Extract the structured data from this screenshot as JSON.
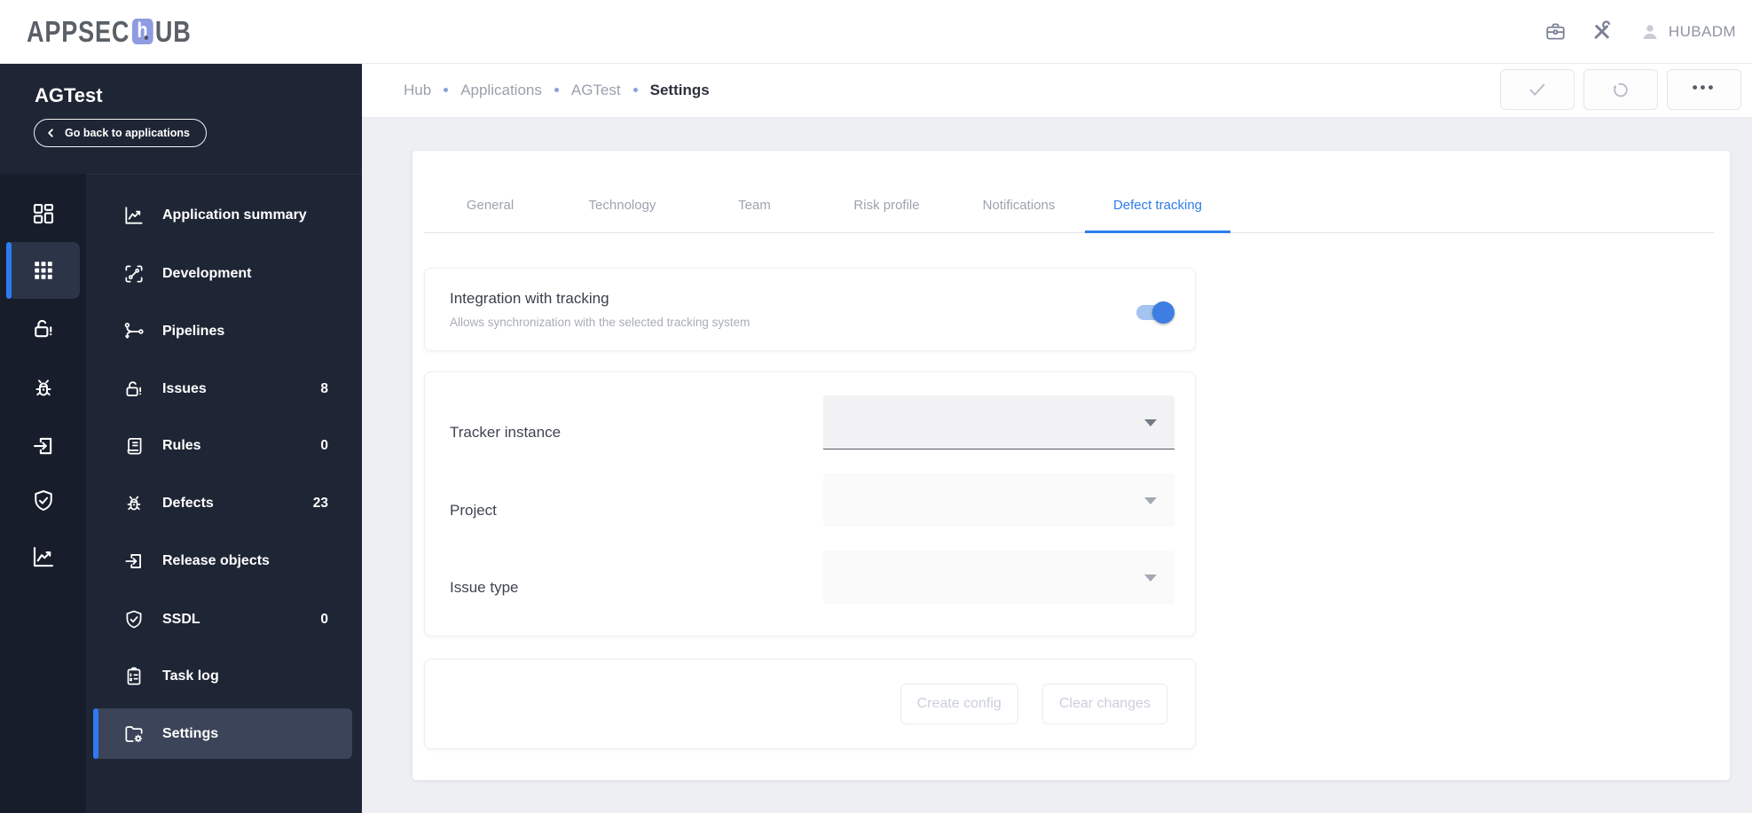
{
  "header": {
    "logo_prefix": "APPSEC",
    "logo_tile_letter": "h",
    "logo_suffix": "UB",
    "icons": [
      "briefcase-icon",
      "tools-icon",
      "user-icon"
    ],
    "username": "HUBADM"
  },
  "sidebar": {
    "app_name": "AGTest",
    "back_button_label": "Go back to applications",
    "rail": [
      {
        "icon": "dashboard-icon",
        "selected": false
      },
      {
        "icon": "apps-grid-icon",
        "selected": true
      },
      {
        "icon": "lock-open-alert-icon",
        "selected": false
      },
      {
        "icon": "bug-icon",
        "selected": false
      },
      {
        "icon": "exit-to-app-icon",
        "selected": false
      },
      {
        "icon": "shield-check-icon",
        "selected": false
      },
      {
        "icon": "line-chart-icon",
        "selected": false
      }
    ],
    "menu": [
      {
        "label": "Application summary",
        "icon": "line-chart-icon"
      },
      {
        "label": "Development",
        "icon": "dev-branch-icon"
      },
      {
        "label": "Pipelines",
        "icon": "pipeline-split-icon"
      },
      {
        "label": "Issues",
        "icon": "lock-open-alert-icon",
        "badge": "8"
      },
      {
        "label": "Rules",
        "icon": "rules-scroll-icon",
        "badge": "0"
      },
      {
        "label": "Defects",
        "icon": "bug-icon",
        "badge": "23"
      },
      {
        "label": "Release objects",
        "icon": "exit-to-app-icon"
      },
      {
        "label": "SSDL",
        "icon": "shield-check-icon",
        "badge": "0"
      },
      {
        "label": "Task log",
        "icon": "task-log-icon"
      },
      {
        "label": "Settings",
        "icon": "folder-gear-icon",
        "selected": true
      }
    ]
  },
  "breadcrumb": {
    "items": [
      "Hub",
      "Applications",
      "AGTest",
      "Settings"
    ],
    "current": "Settings"
  },
  "toolbar": {
    "buttons": [
      {
        "icon": "check-icon"
      },
      {
        "icon": "undo-icon"
      },
      {
        "icon": "ellipsis-icon",
        "glyph": "•••"
      }
    ]
  },
  "tabs": [
    {
      "label": "General",
      "active": false
    },
    {
      "label": "Technology",
      "active": false
    },
    {
      "label": "Team",
      "active": false
    },
    {
      "label": "Risk profile",
      "active": false
    },
    {
      "label": "Notifications",
      "active": false
    },
    {
      "label": "Defect tracking",
      "active": true
    }
  ],
  "content": {
    "integration_card": {
      "title": "Integration with tracking",
      "description": "Allows synchronization with the selected tracking system",
      "toggle_on": true
    },
    "tracker_card": {
      "fields": [
        {
          "label": "Tracker instance",
          "value": ""
        },
        {
          "label": "Project",
          "value": ""
        },
        {
          "label": "Issue type",
          "value": ""
        }
      ]
    },
    "actions_card": {
      "buttons": [
        {
          "label": "Create config",
          "disabled": true
        },
        {
          "label": "Clear changes",
          "disabled": true
        }
      ]
    }
  },
  "colors": {
    "accent": "#2e7bf1",
    "active_tab": "#2e7ce8",
    "toggle_track": "#a6c4f0",
    "toggle_knob": "#3d7de4",
    "sidebar_bg": "#1e2534",
    "rail_bg": "#171d2b",
    "selected_row_bg": "#3b4458",
    "content_bg": "#edeff3"
  }
}
